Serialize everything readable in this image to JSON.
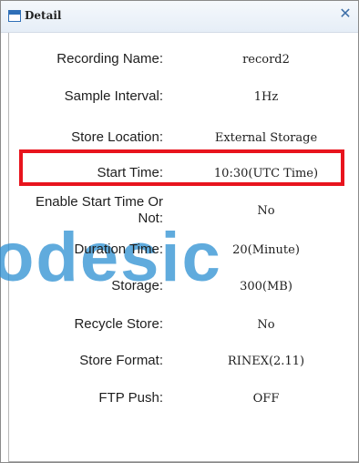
{
  "window": {
    "title": "Detail",
    "close_icon": "close-icon",
    "window_icon": "window-icon"
  },
  "watermark": {
    "text": "odesic"
  },
  "highlight": {
    "color": "#e8141d",
    "field": "Store Location"
  },
  "fields": [
    {
      "label": "Recording Name:",
      "value": "record2"
    },
    {
      "label": "Sample Interval:",
      "value": "1Hz"
    },
    {
      "label": "Store Location:",
      "value": "External Storage"
    },
    {
      "label": "Start Time:",
      "value": "10:30(UTC Time)"
    },
    {
      "label": "Enable Start Time Or Not:",
      "value": "No"
    },
    {
      "label": "Duration Time:",
      "value": "20(Minute)"
    },
    {
      "label": "Storage:",
      "value": "300(MB)"
    },
    {
      "label": "Recycle Store:",
      "value": "No"
    },
    {
      "label": "Store Format:",
      "value": "RINEX(2.11)"
    },
    {
      "label": "FTP Push:",
      "value": "OFF"
    }
  ]
}
